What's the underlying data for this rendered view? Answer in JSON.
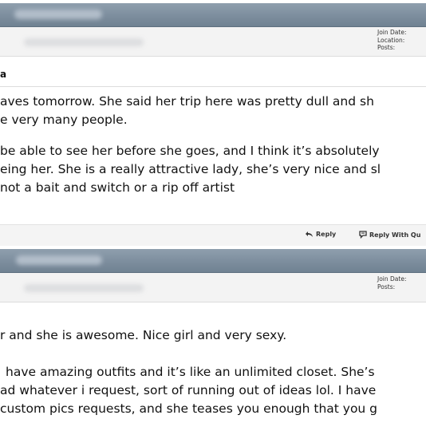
{
  "posts": [
    {
      "user_info": {
        "join_date_label": "Join Date:",
        "location_label": "Location:",
        "posts_label": "Posts:"
      },
      "title": "a",
      "paragraphs": [
        [
          "aves tomorrow. She said her trip here was pretty dull and sh",
          "e very many people."
        ],
        [
          "be able to see her before she goes, and I think it’s absolutely",
          "eing her. She is a really attractive lady, she’s very nice and sl",
          "not a bait and switch or a rip off artist"
        ]
      ],
      "footer": {
        "reply_label": "Reply",
        "reply_quote_label": "Reply With Qu"
      }
    },
    {
      "user_info": {
        "join_date_label": "Join Date:",
        "posts_label": "Posts:"
      },
      "paragraphs": [
        [
          "r and she is awesome. Nice girl and very sexy."
        ],
        [
          "have amazing outfits and it’s like an unlimited closet. She’s",
          "ad whatever i request, sort of running out of ideas lol. I have",
          "custom pics requests, and she teases you enough that you g"
        ]
      ]
    }
  ],
  "icons": {
    "reply": "reply-arrow-icon",
    "quote": "quote-bubble-icon"
  },
  "colors": {
    "header_bar": "#7c8d9d",
    "userinfo_bg": "#f3f3f3",
    "footer_bg": "#f4f4f4",
    "text": "#111111"
  }
}
